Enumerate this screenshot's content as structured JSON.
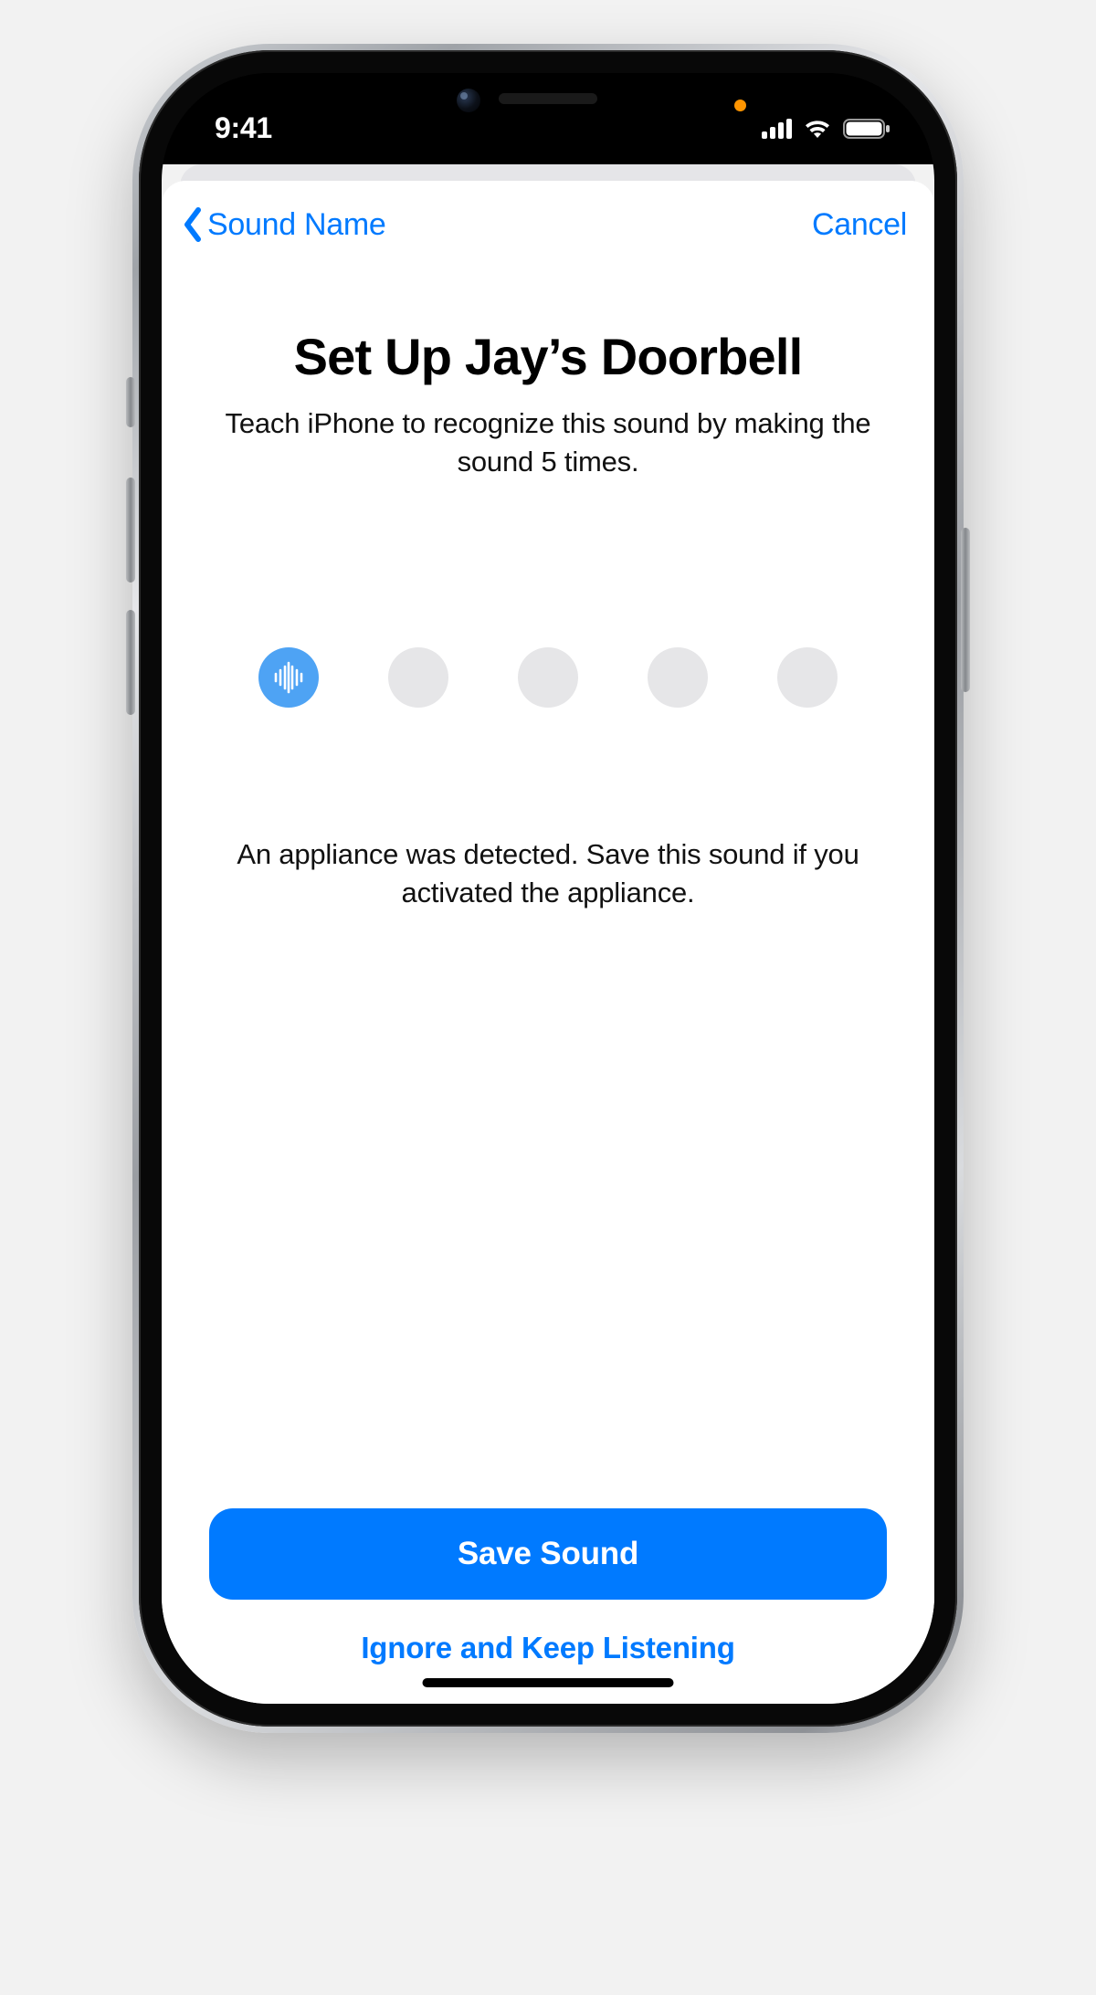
{
  "status": {
    "time": "9:41",
    "mic_indicator_color": "#ff9500"
  },
  "nav": {
    "back_label": "Sound Name",
    "cancel_label": "Cancel"
  },
  "setup": {
    "title": "Set Up Jay’s Doorbell",
    "subtitle": "Teach iPhone to recognize this sound by making the sound 5 times.",
    "total_steps": 5,
    "completed_steps": 1,
    "detection_message": "An appliance was detected. Save this sound if you activated the appliance."
  },
  "actions": {
    "primary": "Save Sound",
    "secondary": "Ignore and Keep Listening"
  },
  "colors": {
    "ios_blue": "#007aff",
    "active_dot": "#4ea3f4",
    "inactive_dot": "#e6e6e8"
  }
}
